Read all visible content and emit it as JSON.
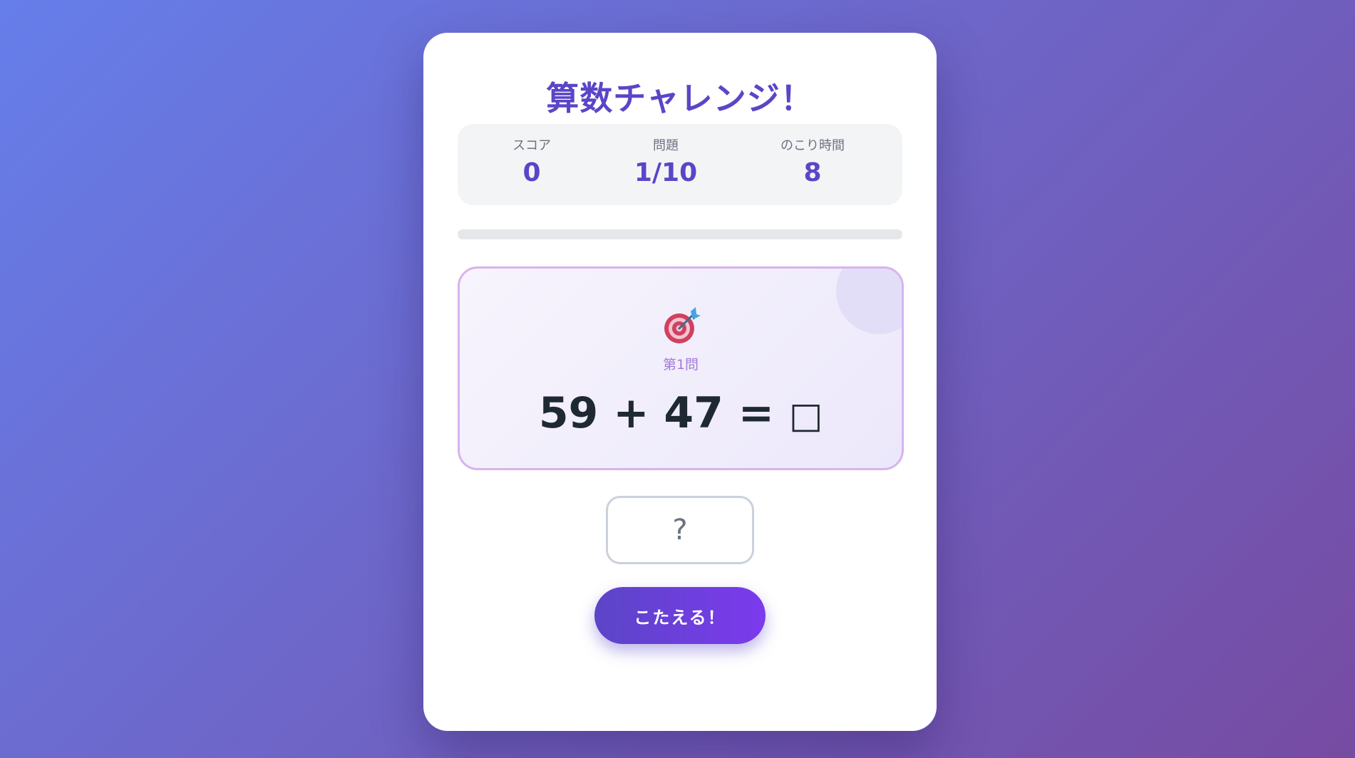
{
  "app": {
    "title": "算数チャレンジ！"
  },
  "stats": {
    "score": {
      "label": "スコア",
      "value": "0"
    },
    "question": {
      "label": "問題",
      "value": "1/10"
    },
    "time_left": {
      "label": "のこり時間",
      "value": "8"
    }
  },
  "progress": {
    "fraction": 0
  },
  "question_card": {
    "icon": "target-icon",
    "number_label": "第1問",
    "operand_a": "59",
    "operator": "+",
    "operand_b": "47",
    "equals": "=",
    "blank": "□"
  },
  "answer": {
    "value": "",
    "placeholder": "?"
  },
  "submit": {
    "label": "こたえる！"
  },
  "colors": {
    "background_start": "#667eea",
    "background_end": "#764ba2",
    "accent": "#5b45c7",
    "button_end": "#7c3aed",
    "question_border": "#d6b3ee"
  }
}
